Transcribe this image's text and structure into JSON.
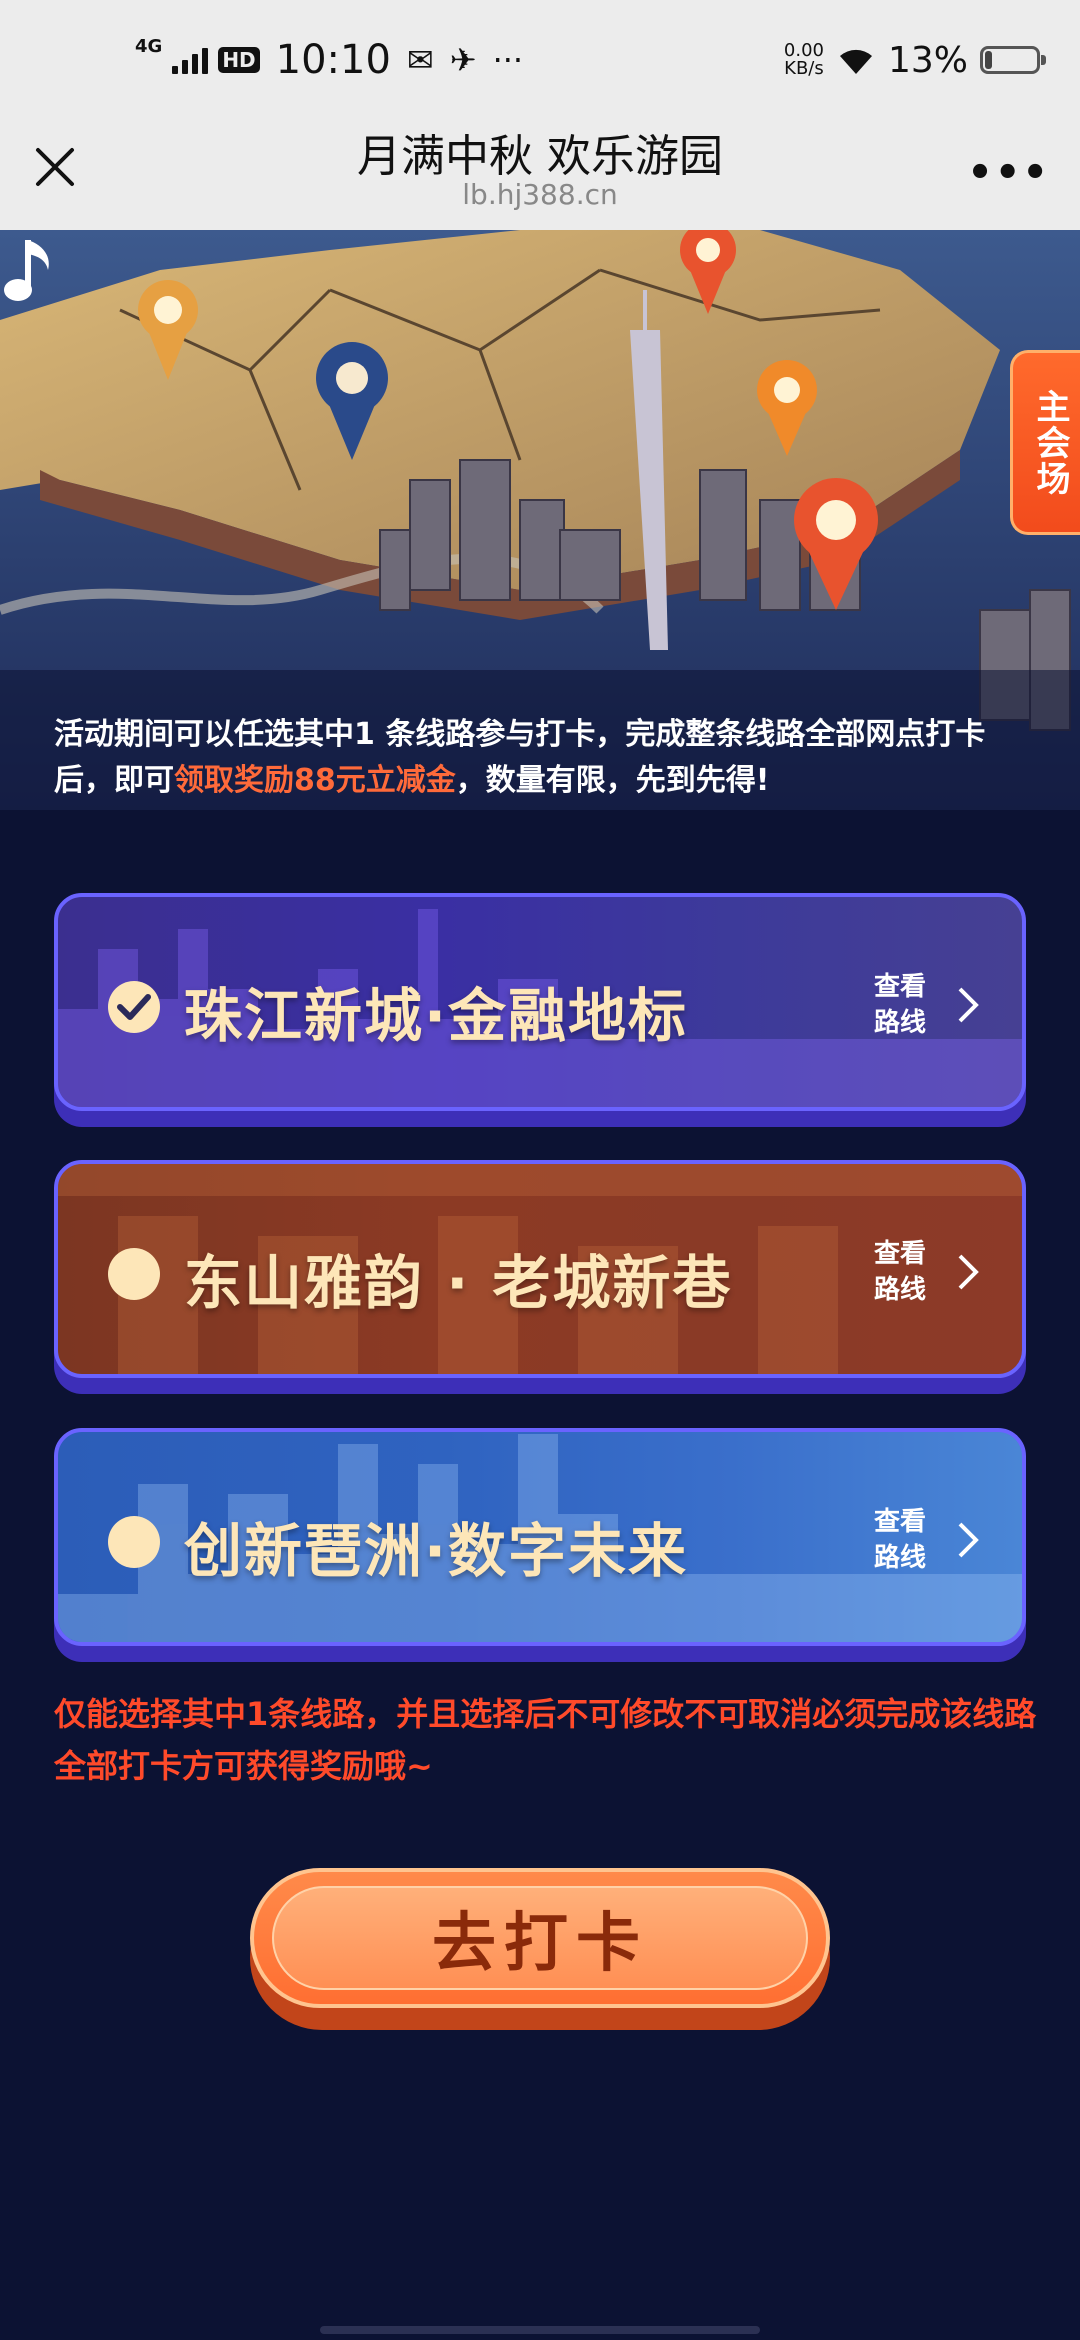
{
  "status_bar": {
    "network": "4G",
    "hd": "HD",
    "time": "10:10",
    "speed_value": "0.00",
    "speed_unit": "KB/s",
    "battery_percent": "13%",
    "battery_level": 0.13
  },
  "title_bar": {
    "title": "月满中秋 欢乐游园",
    "url": "lb.hj388.cn",
    "more": "•••"
  },
  "hero": {
    "side_button": "主会场"
  },
  "intro": {
    "text_before": "活动期间可以任选其中1 条线路参与打卡，完成整条线路全部网点打卡后，即可",
    "highlight": "领取奖励88元立减金",
    "text_after": "，数量有限，先到先得!"
  },
  "routes": [
    {
      "name": "珠江新城·金融地标",
      "view_label_1": "查看",
      "view_label_2": "路线",
      "selected": true
    },
    {
      "name": "东山雅韵 · 老城新巷",
      "view_label_1": "查看",
      "view_label_2": "路线",
      "selected": false
    },
    {
      "name": "创新琶洲·数字未来",
      "view_label_1": "查看",
      "view_label_2": "路线",
      "selected": false
    }
  ],
  "note": "仅能选择其中1条线路，并且选择后不可修改不可取消必须完成该线路全部打卡方可获得奖励哦~",
  "cta": {
    "label": "去打卡"
  },
  "colors": {
    "background": "#0c1233",
    "highlight": "#ff6a3a",
    "note": "#ff4a2a",
    "route_text": "#fde6b8",
    "cta": "#ff7a3c"
  }
}
